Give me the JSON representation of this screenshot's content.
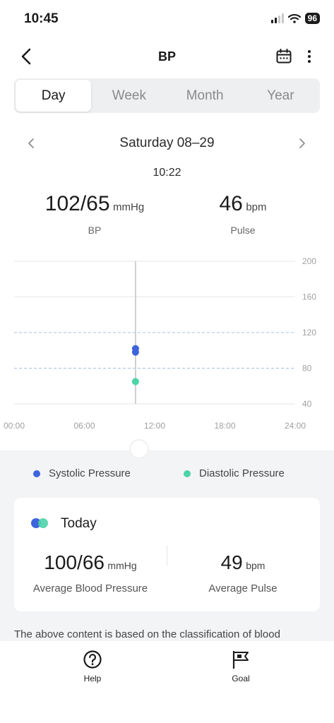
{
  "status_bar": {
    "time": "10:45",
    "battery": "96"
  },
  "nav": {
    "title": "BP"
  },
  "tabs": [
    {
      "label": "Day",
      "active": true
    },
    {
      "label": "Week",
      "active": false
    },
    {
      "label": "Month",
      "active": false
    },
    {
      "label": "Year",
      "active": false
    }
  ],
  "date": {
    "label": "Saturday 08–29"
  },
  "selected": {
    "time": "10:22",
    "bp_value": "102/65",
    "bp_unit": "mmHg",
    "bp_caption": "BP",
    "pulse_value": "46",
    "pulse_unit": "bpm",
    "pulse_caption": "Pulse"
  },
  "chart_data": {
    "type": "scatter",
    "x_ticks": [
      "00:00",
      "06:00",
      "12:00",
      "18:00",
      "24:00"
    ],
    "y_ticks": [
      200,
      160,
      120,
      80,
      40
    ],
    "ylim": [
      40,
      200
    ],
    "reference_lines": [
      120,
      80
    ],
    "cursor_time": "10:22",
    "series": [
      {
        "name": "Systolic Pressure",
        "color": "#3d63dd",
        "points": [
          {
            "x": "10:22",
            "y": 102
          },
          {
            "x": "10:22",
            "y": 98
          }
        ]
      },
      {
        "name": "Diastolic Pressure",
        "color": "#4cd3a8",
        "points": [
          {
            "x": "10:22",
            "y": 65
          }
        ]
      }
    ]
  },
  "legend": {
    "systolic": "Systolic Pressure",
    "diastolic": "Diastolic Pressure"
  },
  "today": {
    "title": "Today",
    "bp_value": "100/66",
    "bp_unit": "mmHg",
    "bp_caption": "Average Blood Pressure",
    "pulse_value": "49",
    "pulse_unit": "bpm",
    "pulse_caption": "Average Pulse"
  },
  "info": "The above content is based on the classification of blood",
  "bottom_tabs": {
    "help": "Help",
    "goal": "Goal"
  },
  "colors": {
    "systolic": "#3d63dd",
    "diastolic": "#4cd3a8"
  }
}
